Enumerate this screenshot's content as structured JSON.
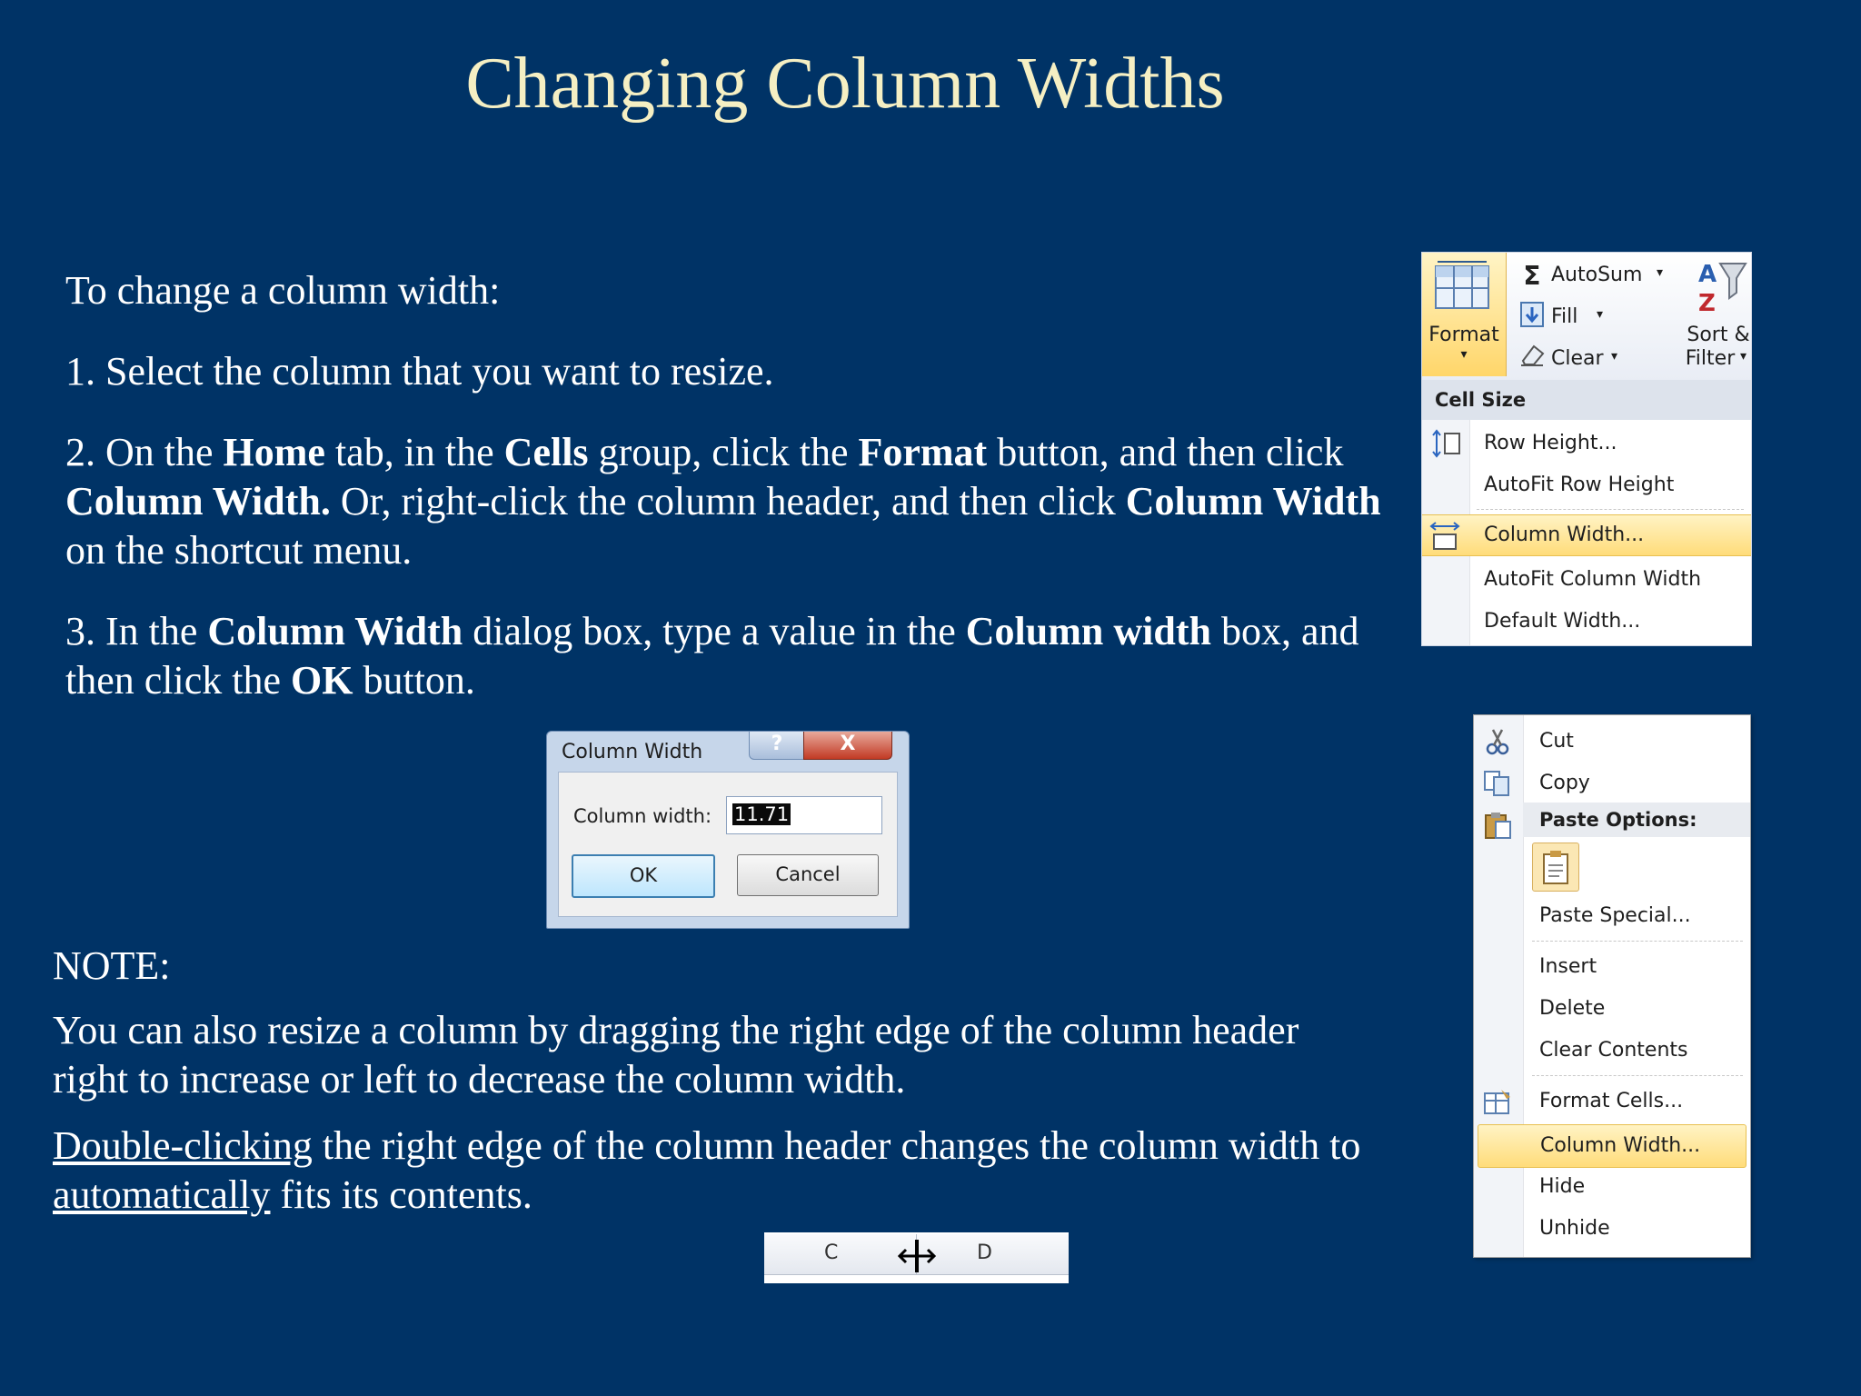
{
  "slide": {
    "title": "Changing Column Widths",
    "intro": "To change a column width:",
    "step1": "1. Select the column that you want to resize.",
    "step2": {
      "t1": "2. On the ",
      "b1": "Home",
      "t2": " tab, in the ",
      "b2": "Cells",
      "t3": " group, click the ",
      "b3": "Format",
      "t4": " button, and then click",
      "b4": "Column Width.",
      "t5": " Or, right-click the column header, and then click ",
      "b5": "Column Width",
      "t6": "on the shortcut menu."
    },
    "step3": {
      "t1": "3. In the ",
      "b1": "Column Width",
      "t2": " dialog box, type a value in the ",
      "b2": "Column width",
      "t3": " box, and",
      "t4": "then click the ",
      "b3": "OK",
      "t5": " button."
    },
    "note_heading": "NOTE:",
    "note1_line1": "You can also resize a column by dragging the right edge of the column header",
    "note1_line2": "right to increase or left to decrease the column width.",
    "note2": {
      "u1": "Double-clicking",
      "t1": " the right edge of the column header changes the column width to",
      "u2": "automatically",
      "t2": " fits its contents."
    }
  },
  "ribbon": {
    "format_label": "Format",
    "autosum": "AutoSum",
    "fill": "Fill",
    "clear": "Clear",
    "sort_line1": "Sort &",
    "sort_line2": "Filter",
    "menu_header": "Cell Size",
    "items": [
      "Row Height...",
      "AutoFit Row Height",
      "Column Width...",
      "AutoFit Column Width",
      "Default Width..."
    ]
  },
  "dialog": {
    "title": "Column Width",
    "help": "?",
    "close": "X",
    "field_label": "Column width:",
    "field_value": "11.71",
    "ok": "OK",
    "cancel": "Cancel"
  },
  "context_menu": {
    "cut": "Cut",
    "copy": "Copy",
    "paste_options": "Paste Options:",
    "paste_special": "Paste Special...",
    "insert": "Insert",
    "delete": "Delete",
    "clear_contents": "Clear Contents",
    "format_cells": "Format Cells...",
    "column_width": "Column Width...",
    "hide": "Hide",
    "unhide": "Unhide"
  },
  "column_header": {
    "left": "C",
    "right": "D"
  },
  "colors": {
    "background": "#003366",
    "title": "#f5efc3",
    "highlight": "#ffdc7a"
  },
  "icons": [
    "sigma-icon",
    "sort-filter-icon",
    "fill-down-icon",
    "eraser-icon",
    "row-height-icon",
    "column-width-icon",
    "scissors-icon",
    "copy-icon",
    "paste-icon",
    "clipboard-icon",
    "format-cells-icon",
    "resize-cursor-icon",
    "format-grid-icon"
  ]
}
